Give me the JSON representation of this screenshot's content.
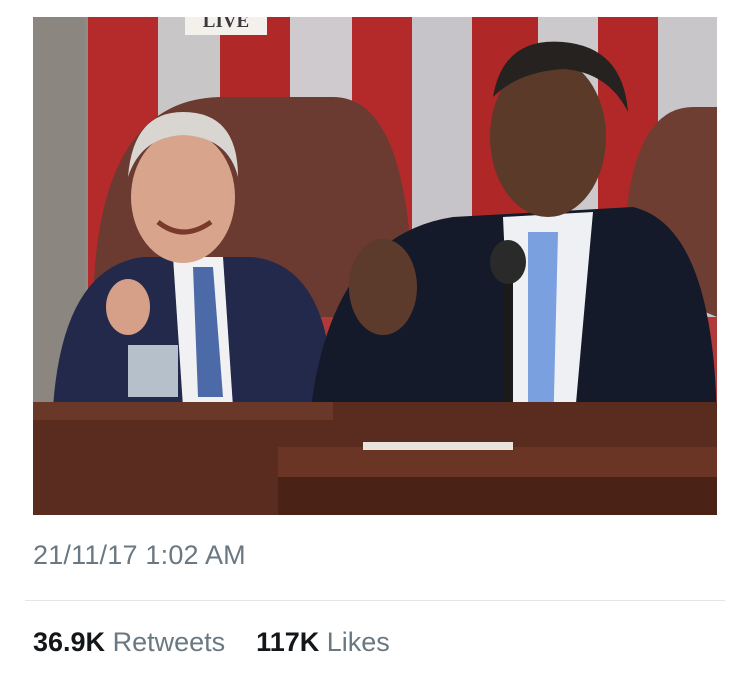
{
  "tweet": {
    "media": {
      "kind": "animated-gif",
      "banner_text": "LIVE"
    },
    "timestamp": "21/11/17 1:02 AM",
    "stats": {
      "retweets_count": "36.9K",
      "retweets_label": "Retweets",
      "likes_count": "117K",
      "likes_label": "Likes"
    }
  },
  "colors": {
    "secondary_text": "#697882",
    "primary_text": "#14171a",
    "divider": "#e1e6ea"
  }
}
